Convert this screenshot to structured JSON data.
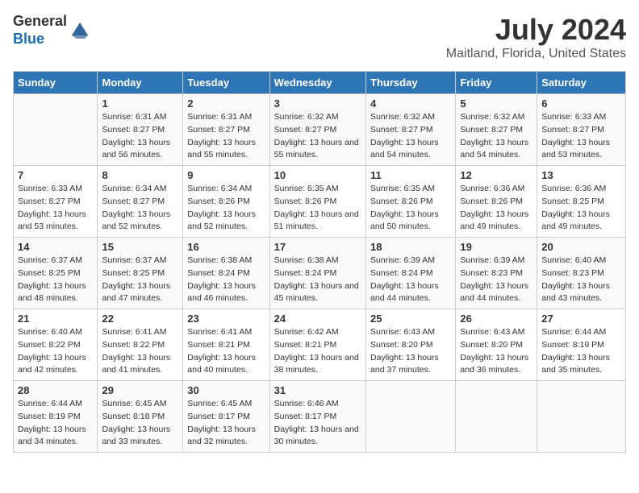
{
  "logo": {
    "general": "General",
    "blue": "Blue"
  },
  "title": "July 2024",
  "subtitle": "Maitland, Florida, United States",
  "days_of_week": [
    "Sunday",
    "Monday",
    "Tuesday",
    "Wednesday",
    "Thursday",
    "Friday",
    "Saturday"
  ],
  "weeks": [
    [
      {
        "day": "",
        "sunrise": "",
        "sunset": "",
        "daylight": ""
      },
      {
        "day": "1",
        "sunrise": "Sunrise: 6:31 AM",
        "sunset": "Sunset: 8:27 PM",
        "daylight": "Daylight: 13 hours and 56 minutes."
      },
      {
        "day": "2",
        "sunrise": "Sunrise: 6:31 AM",
        "sunset": "Sunset: 8:27 PM",
        "daylight": "Daylight: 13 hours and 55 minutes."
      },
      {
        "day": "3",
        "sunrise": "Sunrise: 6:32 AM",
        "sunset": "Sunset: 8:27 PM",
        "daylight": "Daylight: 13 hours and 55 minutes."
      },
      {
        "day": "4",
        "sunrise": "Sunrise: 6:32 AM",
        "sunset": "Sunset: 8:27 PM",
        "daylight": "Daylight: 13 hours and 54 minutes."
      },
      {
        "day": "5",
        "sunrise": "Sunrise: 6:32 AM",
        "sunset": "Sunset: 8:27 PM",
        "daylight": "Daylight: 13 hours and 54 minutes."
      },
      {
        "day": "6",
        "sunrise": "Sunrise: 6:33 AM",
        "sunset": "Sunset: 8:27 PM",
        "daylight": "Daylight: 13 hours and 53 minutes."
      }
    ],
    [
      {
        "day": "7",
        "sunrise": "Sunrise: 6:33 AM",
        "sunset": "Sunset: 8:27 PM",
        "daylight": "Daylight: 13 hours and 53 minutes."
      },
      {
        "day": "8",
        "sunrise": "Sunrise: 6:34 AM",
        "sunset": "Sunset: 8:27 PM",
        "daylight": "Daylight: 13 hours and 52 minutes."
      },
      {
        "day": "9",
        "sunrise": "Sunrise: 6:34 AM",
        "sunset": "Sunset: 8:26 PM",
        "daylight": "Daylight: 13 hours and 52 minutes."
      },
      {
        "day": "10",
        "sunrise": "Sunrise: 6:35 AM",
        "sunset": "Sunset: 8:26 PM",
        "daylight": "Daylight: 13 hours and 51 minutes."
      },
      {
        "day": "11",
        "sunrise": "Sunrise: 6:35 AM",
        "sunset": "Sunset: 8:26 PM",
        "daylight": "Daylight: 13 hours and 50 minutes."
      },
      {
        "day": "12",
        "sunrise": "Sunrise: 6:36 AM",
        "sunset": "Sunset: 8:26 PM",
        "daylight": "Daylight: 13 hours and 49 minutes."
      },
      {
        "day": "13",
        "sunrise": "Sunrise: 6:36 AM",
        "sunset": "Sunset: 8:25 PM",
        "daylight": "Daylight: 13 hours and 49 minutes."
      }
    ],
    [
      {
        "day": "14",
        "sunrise": "Sunrise: 6:37 AM",
        "sunset": "Sunset: 8:25 PM",
        "daylight": "Daylight: 13 hours and 48 minutes."
      },
      {
        "day": "15",
        "sunrise": "Sunrise: 6:37 AM",
        "sunset": "Sunset: 8:25 PM",
        "daylight": "Daylight: 13 hours and 47 minutes."
      },
      {
        "day": "16",
        "sunrise": "Sunrise: 6:38 AM",
        "sunset": "Sunset: 8:24 PM",
        "daylight": "Daylight: 13 hours and 46 minutes."
      },
      {
        "day": "17",
        "sunrise": "Sunrise: 6:38 AM",
        "sunset": "Sunset: 8:24 PM",
        "daylight": "Daylight: 13 hours and 45 minutes."
      },
      {
        "day": "18",
        "sunrise": "Sunrise: 6:39 AM",
        "sunset": "Sunset: 8:24 PM",
        "daylight": "Daylight: 13 hours and 44 minutes."
      },
      {
        "day": "19",
        "sunrise": "Sunrise: 6:39 AM",
        "sunset": "Sunset: 8:23 PM",
        "daylight": "Daylight: 13 hours and 44 minutes."
      },
      {
        "day": "20",
        "sunrise": "Sunrise: 6:40 AM",
        "sunset": "Sunset: 8:23 PM",
        "daylight": "Daylight: 13 hours and 43 minutes."
      }
    ],
    [
      {
        "day": "21",
        "sunrise": "Sunrise: 6:40 AM",
        "sunset": "Sunset: 8:22 PM",
        "daylight": "Daylight: 13 hours and 42 minutes."
      },
      {
        "day": "22",
        "sunrise": "Sunrise: 6:41 AM",
        "sunset": "Sunset: 8:22 PM",
        "daylight": "Daylight: 13 hours and 41 minutes."
      },
      {
        "day": "23",
        "sunrise": "Sunrise: 6:41 AM",
        "sunset": "Sunset: 8:21 PM",
        "daylight": "Daylight: 13 hours and 40 minutes."
      },
      {
        "day": "24",
        "sunrise": "Sunrise: 6:42 AM",
        "sunset": "Sunset: 8:21 PM",
        "daylight": "Daylight: 13 hours and 38 minutes."
      },
      {
        "day": "25",
        "sunrise": "Sunrise: 6:43 AM",
        "sunset": "Sunset: 8:20 PM",
        "daylight": "Daylight: 13 hours and 37 minutes."
      },
      {
        "day": "26",
        "sunrise": "Sunrise: 6:43 AM",
        "sunset": "Sunset: 8:20 PM",
        "daylight": "Daylight: 13 hours and 36 minutes."
      },
      {
        "day": "27",
        "sunrise": "Sunrise: 6:44 AM",
        "sunset": "Sunset: 8:19 PM",
        "daylight": "Daylight: 13 hours and 35 minutes."
      }
    ],
    [
      {
        "day": "28",
        "sunrise": "Sunrise: 6:44 AM",
        "sunset": "Sunset: 8:19 PM",
        "daylight": "Daylight: 13 hours and 34 minutes."
      },
      {
        "day": "29",
        "sunrise": "Sunrise: 6:45 AM",
        "sunset": "Sunset: 8:18 PM",
        "daylight": "Daylight: 13 hours and 33 minutes."
      },
      {
        "day": "30",
        "sunrise": "Sunrise: 6:45 AM",
        "sunset": "Sunset: 8:17 PM",
        "daylight": "Daylight: 13 hours and 32 minutes."
      },
      {
        "day": "31",
        "sunrise": "Sunrise: 6:46 AM",
        "sunset": "Sunset: 8:17 PM",
        "daylight": "Daylight: 13 hours and 30 minutes."
      },
      {
        "day": "",
        "sunrise": "",
        "sunset": "",
        "daylight": ""
      },
      {
        "day": "",
        "sunrise": "",
        "sunset": "",
        "daylight": ""
      },
      {
        "day": "",
        "sunrise": "",
        "sunset": "",
        "daylight": ""
      }
    ]
  ]
}
